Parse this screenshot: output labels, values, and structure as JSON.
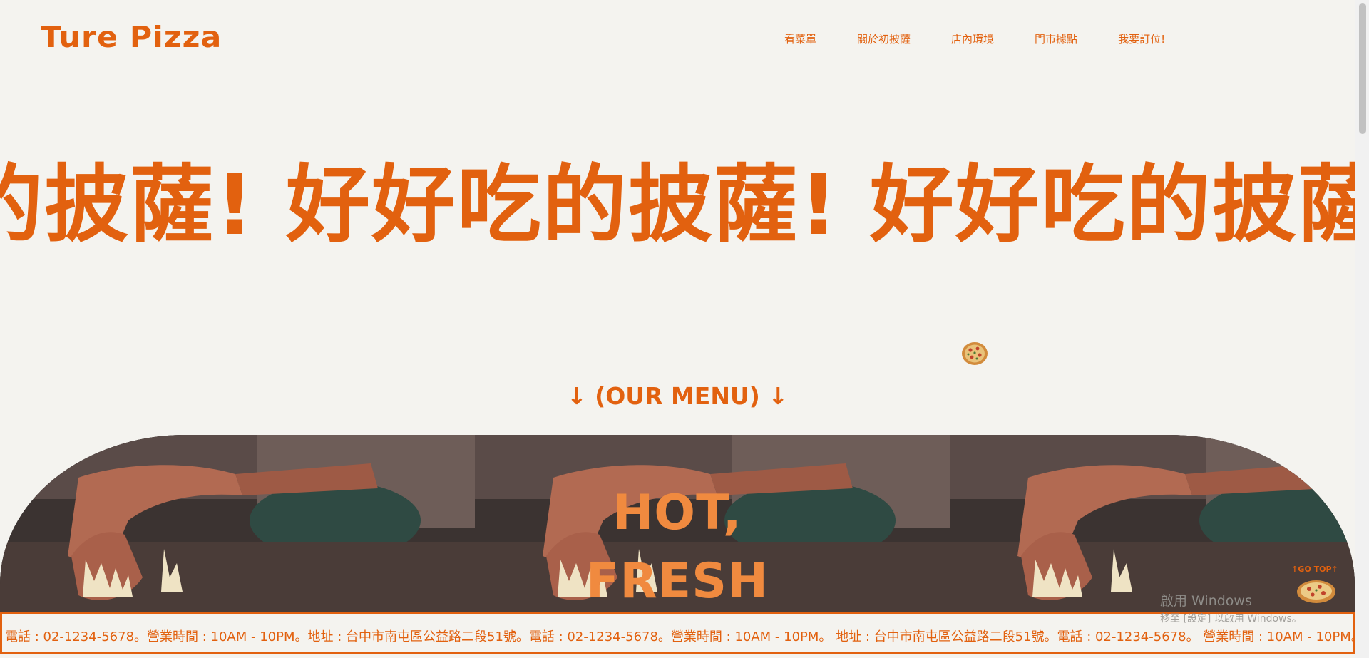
{
  "header": {
    "logo": "Ture Pizza",
    "nav": [
      "看菜單",
      "關於初披薩",
      "店內環境",
      "門市據點",
      "我要訂位!"
    ]
  },
  "marquee": {
    "text": "的披薩! 好好吃的披薩! 好好吃的披薩!"
  },
  "menu": {
    "heading": "↓ (OUR MENU) ↓"
  },
  "hero": {
    "line1": "HOT,",
    "line2": "FRESH"
  },
  "info_ticker": {
    "text": "電話 : 02-1234-5678。營業時間 : 10AM - 10PM。地址 : 台中市南屯區公益路二段51號。電話 : 02-1234-5678。營業時間 : 10AM - 10PM。 地址 : 台中市南屯區公益路二段51號。電話 : 02-1234-5678。 營業時間 : 10AM - 10PM。 地址 : 台"
  },
  "go_top": {
    "label": "↑GO TOP↑"
  },
  "watermark": {
    "title": "啟用 Windows",
    "subtitle": "移至 [設定] 以啟用 Windows。"
  },
  "colors": {
    "accent": "#e2610f",
    "background": "#f4f3ef",
    "hero_text": "#f08a3f"
  }
}
